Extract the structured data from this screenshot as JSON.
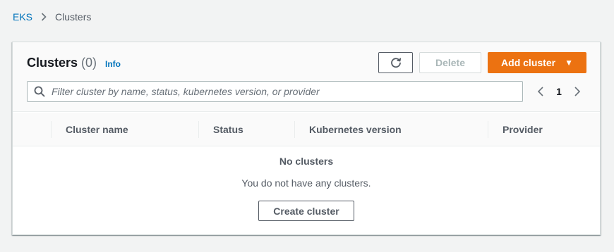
{
  "breadcrumb": {
    "root": "EKS",
    "current": "Clusters"
  },
  "header": {
    "title": "Clusters",
    "count": "(0)",
    "info_label": "Info"
  },
  "toolbar": {
    "refresh_icon": "refresh-icon",
    "delete_label": "Delete",
    "add_label": "Add cluster",
    "add_caret": "▼"
  },
  "filter": {
    "placeholder": "Filter cluster by name, status, kubernetes version, or provider",
    "value": ""
  },
  "pagination": {
    "current_page": "1"
  },
  "table": {
    "columns": [
      "Cluster name",
      "Status",
      "Kubernetes version",
      "Provider"
    ]
  },
  "empty_state": {
    "title": "No clusters",
    "description": "You do not have any clusters.",
    "create_label": "Create cluster"
  },
  "colors": {
    "accent": "#ec7211",
    "link": "#0073bb",
    "background": "#f2f3f3"
  }
}
